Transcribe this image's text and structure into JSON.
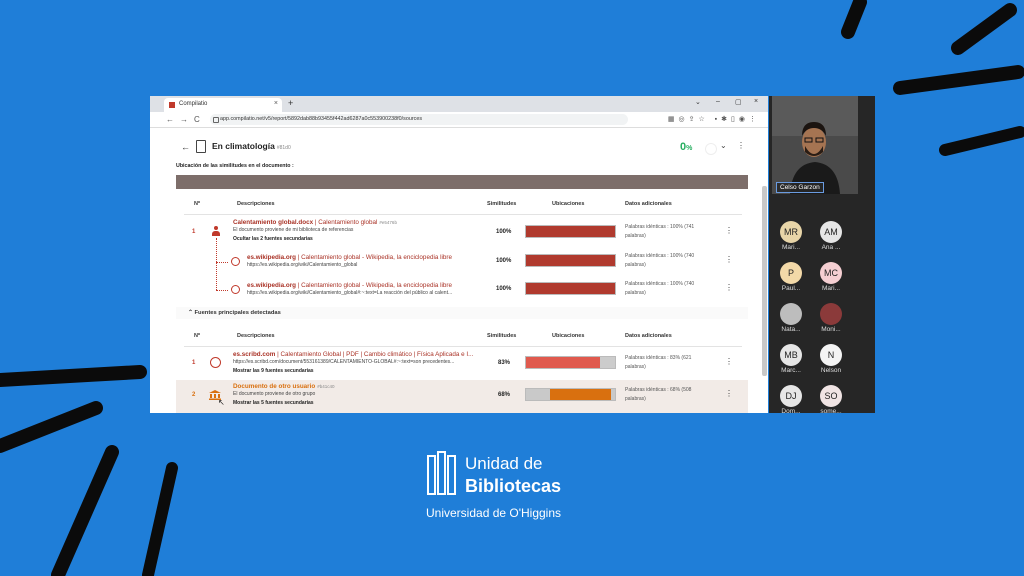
{
  "browser": {
    "tab_title": "Compilatio",
    "tab_close": "×",
    "new_tab": "+",
    "win_controls": [
      "⌄",
      "–",
      "▢",
      "×"
    ],
    "nav": [
      "←",
      "→",
      "C"
    ],
    "url": "app.compilatio.net/v5/report/5892dab88b93455f442ad6287a0c553900238f0/sources"
  },
  "report": {
    "title": "En climatología",
    "doc_id": "#81d0",
    "score": "0",
    "score_unit": "%",
    "section_label": "Ubicación de las similitudes en el documento :",
    "columns": [
      "Nº",
      "Descripciones",
      "Similitudes",
      "Ubicaciones",
      "Datos adicionales"
    ],
    "sources_group": [
      {
        "number": "1",
        "title_bold": "Calentamiento global.docx",
        "title_rest": " | Calentamiento global",
        "id": "#e5476b",
        "subtitle": "El documento proviene de mi biblioteca de referencias",
        "toggle": "Ocultar las 2 fuentes secundarias",
        "similarity": "100%",
        "fill": 1.0,
        "extra": "Palabras idénticas : 100% (741 palabras)"
      },
      {
        "title_bold": "es.wikipedia.org",
        "title_rest": " | Calentamiento global - Wikipedia, la enciclopedia libre",
        "subtitle": "https://es.wikipedia.org/wiki/Calentamiento_global",
        "similarity": "100%",
        "fill": 1.0,
        "extra": "Palabras idénticas : 100% (740 palabras)"
      },
      {
        "title_bold": "es.wikipedia.org",
        "title_rest": " | Calentamiento global - Wikipedia, la enciclopedia libre",
        "subtitle": "https://es.wikipedia.org/wiki/Calentamiento_global#:~:text=La reacción del público al calent...",
        "similarity": "100%",
        "fill": 1.0,
        "extra": "Palabras idénticas : 100% (740 palabras)"
      }
    ],
    "main_sources_label": "Fuentes principales detectadas",
    "main_sources": [
      {
        "number": "1",
        "title_bold": "es.scribd.com",
        "title_rest": " | Calentamiento Global | PDF | Cambio climático | Física Aplicada e I...",
        "subtitle": "https://es.scribd.com/document/553161389/CALENTAMIENTO-GLOBAL#:~:text=son precedentes...",
        "toggle": "Mostrar las 9 fuentes secundarias",
        "similarity": "83%",
        "fill": 0.83,
        "extra": "Palabras idénticas : 83% (621 palabras)"
      },
      {
        "number": "2",
        "title_bold": "Documento de otro usuario",
        "title_rest": "",
        "id": "#b41c40",
        "subtitle": "El documento proviene de otro grupo",
        "toggle": "Mostrar las 5 fuentes secundarias",
        "similarity": "68%",
        "fill": 0.68,
        "extra": "Palabras idénticas : 68% (508 palabras)"
      }
    ]
  },
  "meeting": {
    "self_name": "Celso Garzon",
    "participants": [
      {
        "initials": "MR",
        "name": "Mari...",
        "color": "#e8d5a8"
      },
      {
        "initials": "AM",
        "name": "Ana ...",
        "color": "#e6e6e6"
      },
      {
        "initials": "P",
        "name": "Paul...",
        "color": "#f3d9a8"
      },
      {
        "initials": "MC",
        "name": "Mari...",
        "color": "#f5cfd2"
      },
      {
        "initials": "",
        "name": "Nata...",
        "color": "#bdbdbd"
      },
      {
        "initials": "",
        "name": "Moni...",
        "color": "#8b3a3a"
      },
      {
        "initials": "MB",
        "name": "Marc...",
        "color": "#e6e6e6"
      },
      {
        "initials": "N",
        "name": "Nelson",
        "color": "#f4f4f4"
      },
      {
        "initials": "DJ",
        "name": "Dom...",
        "color": "#e6e6e6"
      },
      {
        "initials": "SO",
        "name": "some...",
        "color": "#f0e4e4"
      }
    ]
  },
  "branding": {
    "line1": "Unidad de",
    "line2": "Bibliotecas",
    "line3": "Universidad de O'Higgins"
  },
  "colors": {
    "background": "#1f7ed8",
    "accent_red": "#a93226",
    "bar_red": "#b03a2e",
    "bar_light_red": "#e05a4e",
    "bar_orange": "#d9700f",
    "score_green": "#27ae60"
  }
}
